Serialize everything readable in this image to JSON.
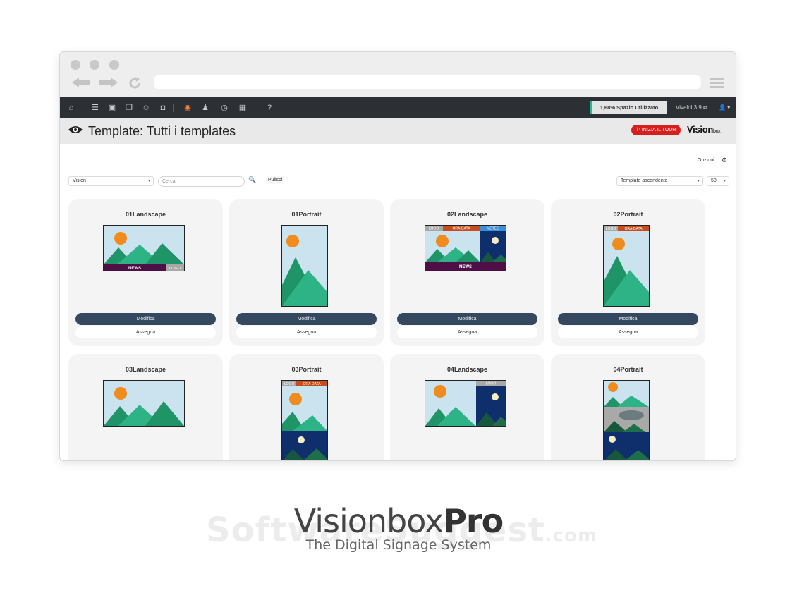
{
  "toolbar": {
    "usage_text": "1,68% Spazio Utilizzato",
    "version_link": "Vivaldi 3.9 ⧉",
    "user_menu": "▾"
  },
  "header": {
    "title": "Template: Tutti i templates",
    "tour_button": "⚐ INIZIA IL TOUR",
    "logo_main": "Vision",
    "logo_sub": "box"
  },
  "options": {
    "label": "Opzioni"
  },
  "filters": {
    "group_select": "Vision",
    "search_placeholder": "Cerca",
    "clear_label": "Pulisci",
    "sort_select": "Template ascendente",
    "page_size": "50"
  },
  "cards": [
    {
      "title": "01Landscape",
      "edit": "Modifica",
      "assign": "Assegna"
    },
    {
      "title": "01Portrait",
      "edit": "Modifica",
      "assign": "Assegna"
    },
    {
      "title": "02Landscape",
      "edit": "Modifica",
      "assign": "Assegna"
    },
    {
      "title": "02Portrait",
      "edit": "Modifica",
      "assign": "Assegna"
    },
    {
      "title": "03Landscape"
    },
    {
      "title": "03Portrait"
    },
    {
      "title": "04Landscape"
    },
    {
      "title": "04Portrait"
    }
  ],
  "thumb_labels": {
    "news": "NEWS",
    "logo": "LOGO",
    "ora_data": "ORA-DATA",
    "meteo": "METEO"
  },
  "brand": {
    "name_light": "Visionbox",
    "name_bold": "Pro",
    "tagline": "The Digital Signage System"
  },
  "watermark": {
    "text": "SoftwareSuggest",
    "suffix": ".com"
  },
  "colors": {
    "topbar": "#2c2f33",
    "primary_button": "#34485f",
    "tour_button": "#d61f1f",
    "sky": "#cbe3ee",
    "sun": "#f08c1e",
    "mountain_dark": "#1e9467",
    "mountain_light": "#2eb386",
    "news_bar": "#4d0f45",
    "ora_data_bar": "#c84d1c"
  }
}
